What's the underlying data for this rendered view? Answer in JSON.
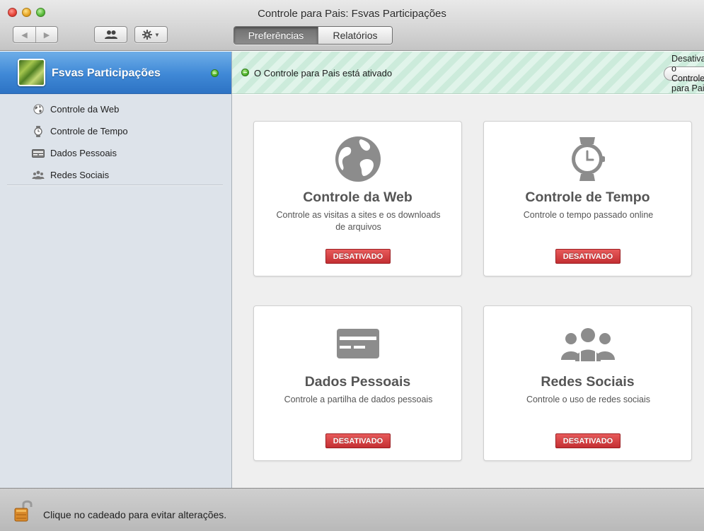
{
  "window": {
    "title": "Controle para Pais: Fsvas Participações"
  },
  "toolbar": {
    "segments": [
      {
        "label": "Preferências",
        "active": true
      },
      {
        "label": "Relatórios",
        "active": false
      }
    ]
  },
  "sidebar": {
    "user": {
      "name": "Fsvas Participações",
      "status": "active"
    },
    "items": [
      {
        "label": "Controle da Web",
        "icon": "globe-icon"
      },
      {
        "label": "Controle de Tempo",
        "icon": "watch-icon"
      },
      {
        "label": "Dados Pessoais",
        "icon": "card-icon"
      },
      {
        "label": "Redes Sociais",
        "icon": "people-icon"
      }
    ]
  },
  "status_bar": {
    "text": "O Controle para Pais está ativado",
    "button_label": "Desativar o Controle para Pais"
  },
  "cards": [
    {
      "title": "Controle da Web",
      "description": "Controle as visitas a sites e os downloads de arquivos",
      "badge": "DESATIVADO",
      "icon": "globe-icon"
    },
    {
      "title": "Controle de Tempo",
      "description": "Controle o tempo passado online",
      "badge": "DESATIVADO",
      "icon": "watch-icon"
    },
    {
      "title": "Dados Pessoais",
      "description": "Controle a partilha de dados pessoais",
      "badge": "DESATIVADO",
      "icon": "card-icon"
    },
    {
      "title": "Redes Sociais",
      "description": "Controle o uso de redes sociais",
      "badge": "DESATIVADO",
      "icon": "people-icon"
    }
  ],
  "footer": {
    "text": "Clique no cadeado para evitar alterações."
  },
  "colors": {
    "accent_blue": "#3f88d6",
    "status_green": "#4fb22c",
    "badge_red": "#c32f33",
    "icon_gray": "#8c8c8c"
  }
}
